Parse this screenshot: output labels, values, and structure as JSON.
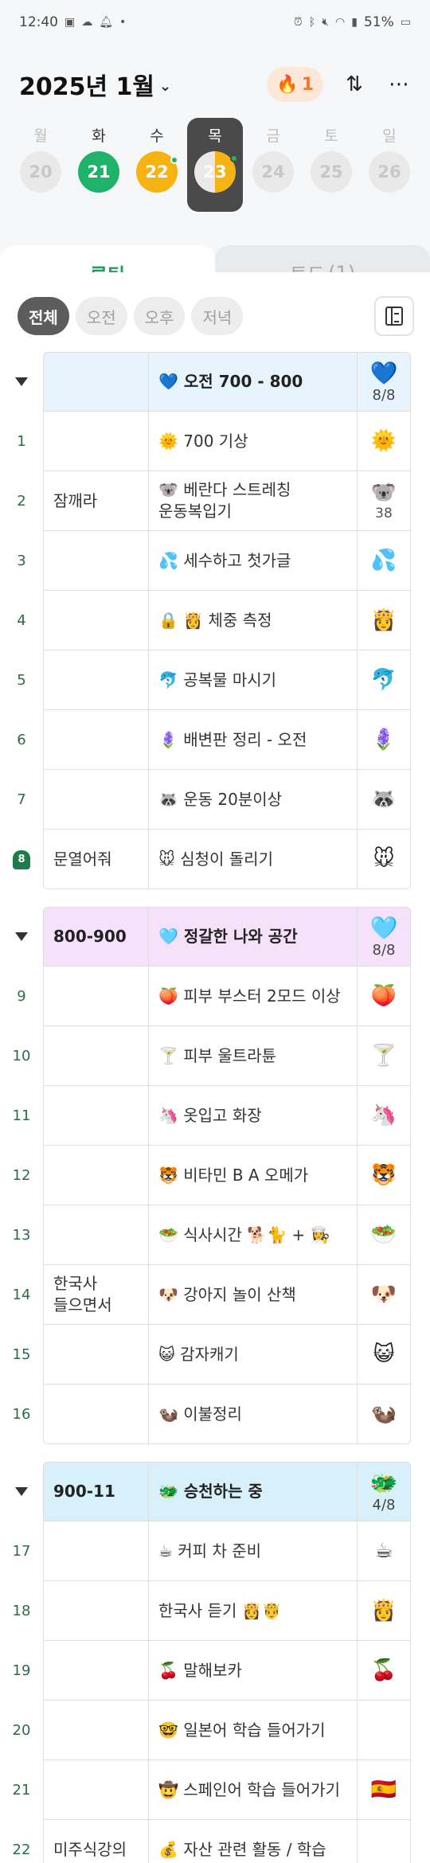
{
  "status": {
    "time": "12:40",
    "battery": "51%"
  },
  "header": {
    "month_label": "2025년 1월",
    "streak_count": "1",
    "streak_icon": "🔥"
  },
  "week": [
    {
      "name": "월",
      "num": "20",
      "state": "plain"
    },
    {
      "name": "화",
      "num": "21",
      "state": "green"
    },
    {
      "name": "수",
      "num": "22",
      "state": "yellow"
    },
    {
      "name": "목",
      "num": "23",
      "state": "today"
    },
    {
      "name": "금",
      "num": "24",
      "state": "plain"
    },
    {
      "name": "토",
      "num": "25",
      "state": "plain"
    },
    {
      "name": "일",
      "num": "26",
      "state": "plain"
    }
  ],
  "tabs": {
    "routine": "루틴",
    "todo": "투두",
    "todo_count": "(1)"
  },
  "filters": [
    "전체",
    "오전",
    "오후",
    "저녁"
  ],
  "sections": [
    {
      "theme": "blue",
      "col1": "",
      "title": "💙 오전  700 - 800",
      "badge": "💙",
      "progress": "8/8",
      "rows": [
        {
          "num": "1",
          "col1": "",
          "task": "🌞  700  기상",
          "icon": "🌞",
          "sub": ""
        },
        {
          "num": "2",
          "col1": "잠깨라",
          "task": "🐨 베란다 스트레칭\n운동복입기",
          "icon": "🐨",
          "sub": "38"
        },
        {
          "num": "3",
          "col1": "",
          "task": "💦  세수하고 첫가글",
          "icon": "💦",
          "sub": ""
        },
        {
          "num": "4",
          "col1": "",
          "task": "🔒 👸  체중 측정",
          "icon": "👸",
          "sub": ""
        },
        {
          "num": "5",
          "col1": "",
          "task": "🐬  공복물 마시기",
          "icon": "🐬",
          "sub": ""
        },
        {
          "num": "6",
          "col1": "",
          "task": "🪻  배변판 정리 - 오전",
          "icon": "🪻",
          "sub": ""
        },
        {
          "num": "7",
          "col1": "",
          "task": "🦝  운동 20분이상",
          "icon": "🦝",
          "sub": ""
        },
        {
          "num": "8",
          "col1": "문열어줘",
          "task": "🐭  심청이 돌리기",
          "icon": "🐭",
          "sub": "",
          "bell": true
        }
      ]
    },
    {
      "theme": "pink",
      "col1": "800-900",
      "title": "🩵 정갈한 나와 공간",
      "badge": "🩵",
      "progress": "8/8",
      "rows": [
        {
          "num": "9",
          "col1": "",
          "task": "🍑  피부 부스터 2모드 이상",
          "icon": "🍑",
          "sub": ""
        },
        {
          "num": "10",
          "col1": "",
          "task": "🍸  피부 울트라튠",
          "icon": "🍸",
          "sub": ""
        },
        {
          "num": "11",
          "col1": "",
          "task": "🦄  옷입고 화장",
          "icon": "🦄",
          "sub": ""
        },
        {
          "num": "12",
          "col1": "",
          "task": "🐯  비타민 B A 오메가",
          "icon": "🐯",
          "sub": ""
        },
        {
          "num": "13",
          "col1": "",
          "task": "🥗  식사시간  🐕🐈 + 👩‍🍳",
          "icon": "🥗",
          "sub": ""
        },
        {
          "num": "14",
          "col1": "한국사\n들으면서",
          "task": "🐶 강아지 놀이 산책",
          "icon": "🐶",
          "sub": ""
        },
        {
          "num": "15",
          "col1": "",
          "task": "😺  감자캐기",
          "icon": "😺",
          "sub": ""
        },
        {
          "num": "16",
          "col1": "",
          "task": "🦦  이불정리",
          "icon": "🦦",
          "sub": ""
        }
      ]
    },
    {
      "theme": "sky",
      "col1": "900-11",
      "title": "🐲 승천하는 중",
      "badge": "🐲",
      "progress": "4/8",
      "rows": [
        {
          "num": "17",
          "col1": "",
          "task": "☕  커피 차 준비",
          "icon": "☕",
          "sub": ""
        },
        {
          "num": "18",
          "col1": "",
          "task": "한국사 듣기 👸🤴",
          "icon": "👸",
          "sub": ""
        },
        {
          "num": "19",
          "col1": "",
          "task": "🍒  말해보카",
          "icon": "🍒",
          "sub": ""
        },
        {
          "num": "20",
          "col1": "",
          "task": "🤓  일본어 학습 들어가기",
          "icon": "",
          "sub": ""
        },
        {
          "num": "21",
          "col1": "",
          "task": "🤠  스페인어 학습 들어가기",
          "icon": "🇪🇸",
          "sub": ""
        },
        {
          "num": "22",
          "col1": "미주식강의",
          "task": "💰  자산 관련 활동 / 학습",
          "icon": "",
          "sub": ""
        }
      ]
    }
  ]
}
